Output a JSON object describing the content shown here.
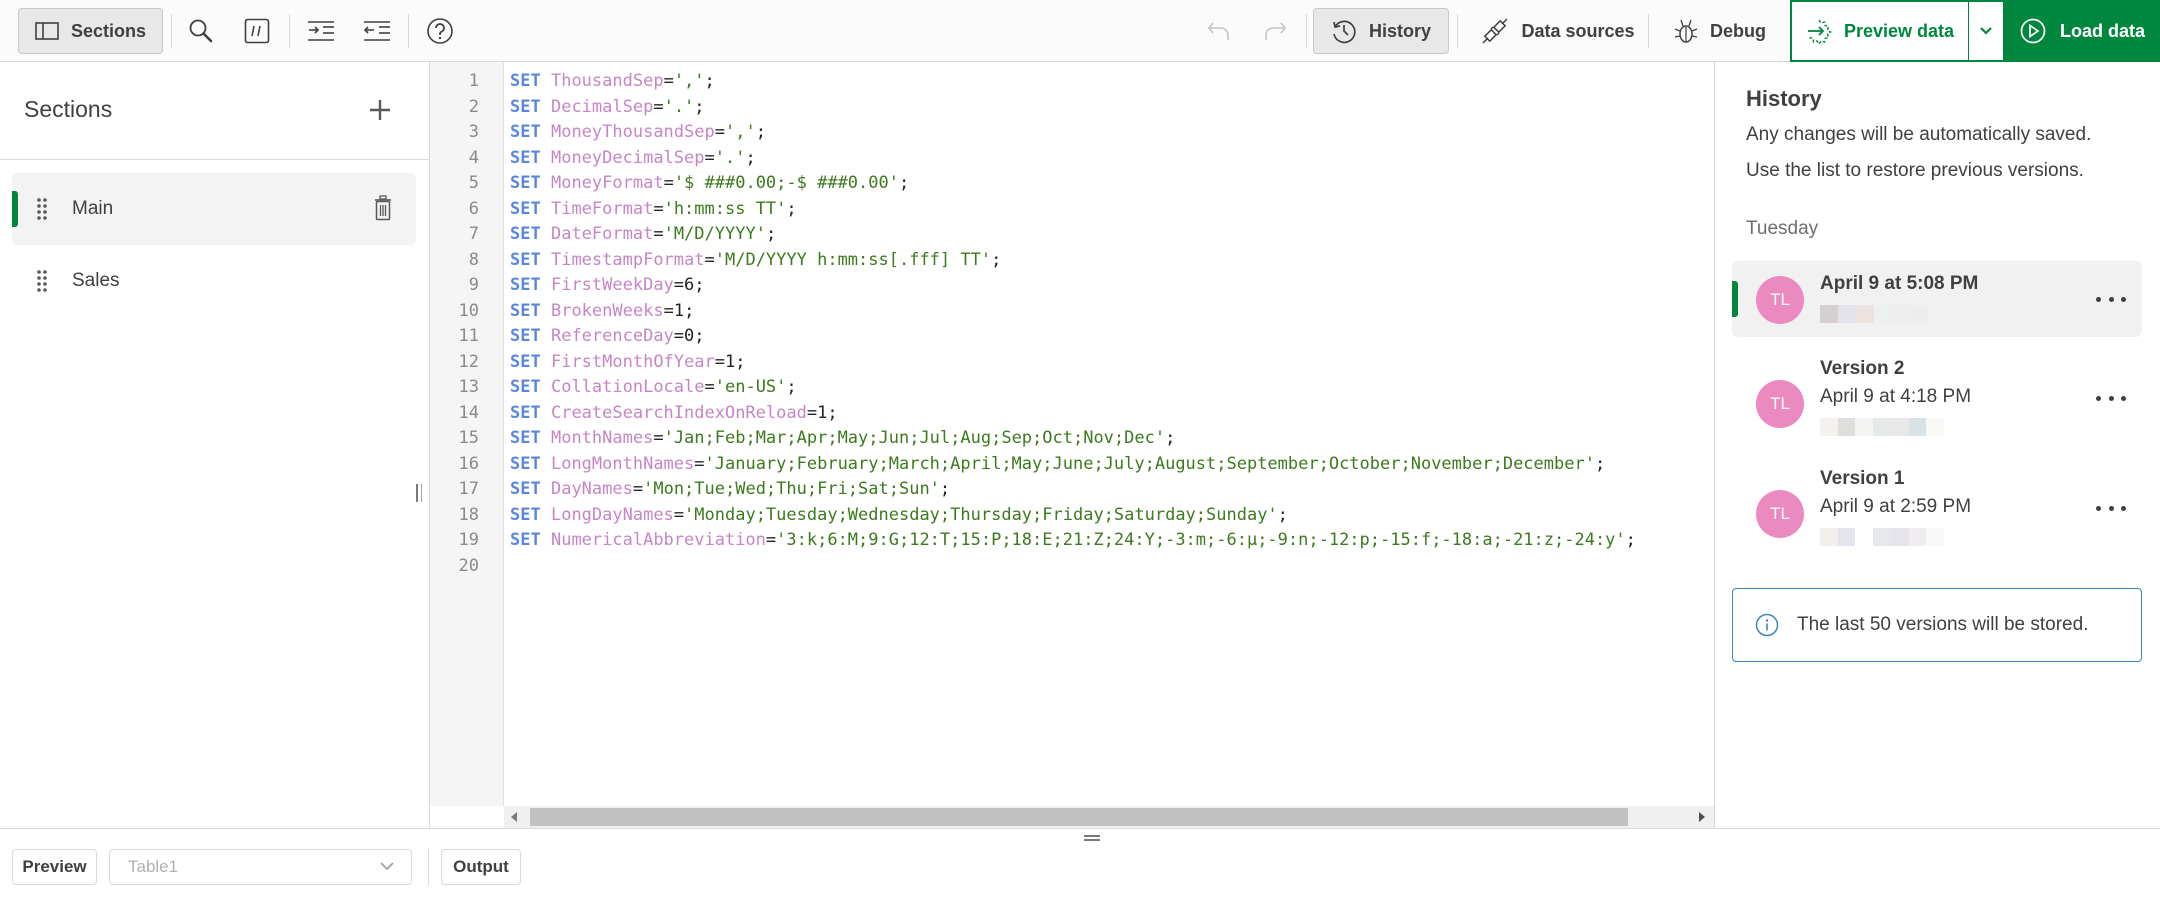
{
  "toolbar": {
    "sections_label": "Sections",
    "icons": [
      "search-icon",
      "comment-icon",
      "indent-icon",
      "outdent-icon",
      "help-icon",
      "undo-icon",
      "redo-icon"
    ],
    "history_label": "History",
    "data_sources_label": "Data sources",
    "debug_label": "Debug",
    "preview_data_label": "Preview data",
    "load_data_label": "Load data",
    "accent_color": "#00873d"
  },
  "sections": {
    "title": "Sections",
    "items": [
      {
        "label": "Main",
        "active": true
      },
      {
        "label": "Sales",
        "active": false
      }
    ]
  },
  "editor": {
    "lines": [
      {
        "n": "1",
        "kw": "SET",
        "var": "ThousandSep",
        "eq": "=",
        "val": "','",
        "val_type": "str",
        "end": ";"
      },
      {
        "n": "2",
        "kw": "SET",
        "var": "DecimalSep",
        "eq": "=",
        "val": "'.'",
        "val_type": "str",
        "end": ";"
      },
      {
        "n": "3",
        "kw": "SET",
        "var": "MoneyThousandSep",
        "eq": "=",
        "val": "','",
        "val_type": "str",
        "end": ";"
      },
      {
        "n": "4",
        "kw": "SET",
        "var": "MoneyDecimalSep",
        "eq": "=",
        "val": "'.'",
        "val_type": "str",
        "end": ";"
      },
      {
        "n": "5",
        "kw": "SET",
        "var": "MoneyFormat",
        "eq": "=",
        "val": "'$ ###0.00;-$ ###0.00'",
        "val_type": "str",
        "end": ";"
      },
      {
        "n": "6",
        "kw": "SET",
        "var": "TimeFormat",
        "eq": "=",
        "val": "'h:mm:ss TT'",
        "val_type": "str",
        "end": ";"
      },
      {
        "n": "7",
        "kw": "SET",
        "var": "DateFormat",
        "eq": "=",
        "val": "'M/D/YYYY'",
        "val_type": "str",
        "end": ";"
      },
      {
        "n": "8",
        "kw": "SET",
        "var": "TimestampFormat",
        "eq": "=",
        "val": "'M/D/YYYY h:mm:ss[.fff] TT'",
        "val_type": "str",
        "end": ";"
      },
      {
        "n": "9",
        "kw": "SET",
        "var": "FirstWeekDay",
        "eq": "=",
        "val": "6",
        "val_type": "num",
        "end": ";"
      },
      {
        "n": "10",
        "kw": "SET",
        "var": "BrokenWeeks",
        "eq": "=",
        "val": "1",
        "val_type": "num",
        "end": ";"
      },
      {
        "n": "11",
        "kw": "SET",
        "var": "ReferenceDay",
        "eq": "=",
        "val": "0",
        "val_type": "num",
        "end": ";"
      },
      {
        "n": "12",
        "kw": "SET",
        "var": "FirstMonthOfYear",
        "eq": "=",
        "val": "1",
        "val_type": "num",
        "end": ";"
      },
      {
        "n": "13",
        "kw": "SET",
        "var": "CollationLocale",
        "eq": "=",
        "val": "'en-US'",
        "val_type": "str",
        "end": ";"
      },
      {
        "n": "14",
        "kw": "SET",
        "var": "CreateSearchIndexOnReload",
        "eq": "=",
        "val": "1",
        "val_type": "num",
        "end": ";"
      },
      {
        "n": "15",
        "kw": "SET",
        "var": "MonthNames",
        "eq": "=",
        "val": "'Jan;Feb;Mar;Apr;May;Jun;Jul;Aug;Sep;Oct;Nov;Dec'",
        "val_type": "str",
        "end": ";"
      },
      {
        "n": "16",
        "kw": "SET",
        "var": "LongMonthNames",
        "eq": "=",
        "val": "'January;February;March;April;May;June;July;August;September;October;November;December'",
        "val_type": "str",
        "end": ";"
      },
      {
        "n": "17",
        "kw": "SET",
        "var": "DayNames",
        "eq": "=",
        "val": "'Mon;Tue;Wed;Thu;Fri;Sat;Sun'",
        "val_type": "str",
        "end": ";"
      },
      {
        "n": "18",
        "kw": "SET",
        "var": "LongDayNames",
        "eq": "=",
        "val": "'Monday;Tuesday;Wednesday;Thursday;Friday;Saturday;Sunday'",
        "val_type": "str",
        "end": ";"
      },
      {
        "n": "19",
        "kw": "SET",
        "var": "NumericalAbbreviation",
        "eq": "=",
        "val": "'3:k;6:M;9:G;12:T;15:P;18:E;21:Z;24:Y;-3:m;-6:μ;-9:n;-12:p;-15:f;-18:a;-21:z;-24:y'",
        "val_type": "str",
        "end": ";"
      },
      {
        "n": "20",
        "kw": "",
        "var": "",
        "eq": "",
        "val": "",
        "val_type": "str",
        "end": ""
      }
    ],
    "syntax_colors": {
      "keyword": "#5a87d8",
      "variable": "#c686c5",
      "string": "#3d7a1e"
    }
  },
  "history": {
    "title": "History",
    "desc_line1": "Any changes will be automatically saved.",
    "desc_line2": "Use the list to restore previous versions.",
    "day_label": "Tuesday",
    "versions": [
      {
        "title": "April 9 at 5:08 PM",
        "subtitle": "",
        "initials": "TL",
        "active": true
      },
      {
        "title": "Version 2",
        "subtitle": "April 9 at 4:18 PM",
        "initials": "TL",
        "active": false
      },
      {
        "title": "Version 1",
        "subtitle": "April 9 at 2:59 PM",
        "initials": "TL",
        "active": false
      }
    ],
    "info_message": "The last 50 versions will be stored.",
    "avatar_color": "#ea8ac1"
  },
  "bottom": {
    "preview_label": "Preview",
    "table_select_value": "Table1",
    "output_label": "Output"
  }
}
